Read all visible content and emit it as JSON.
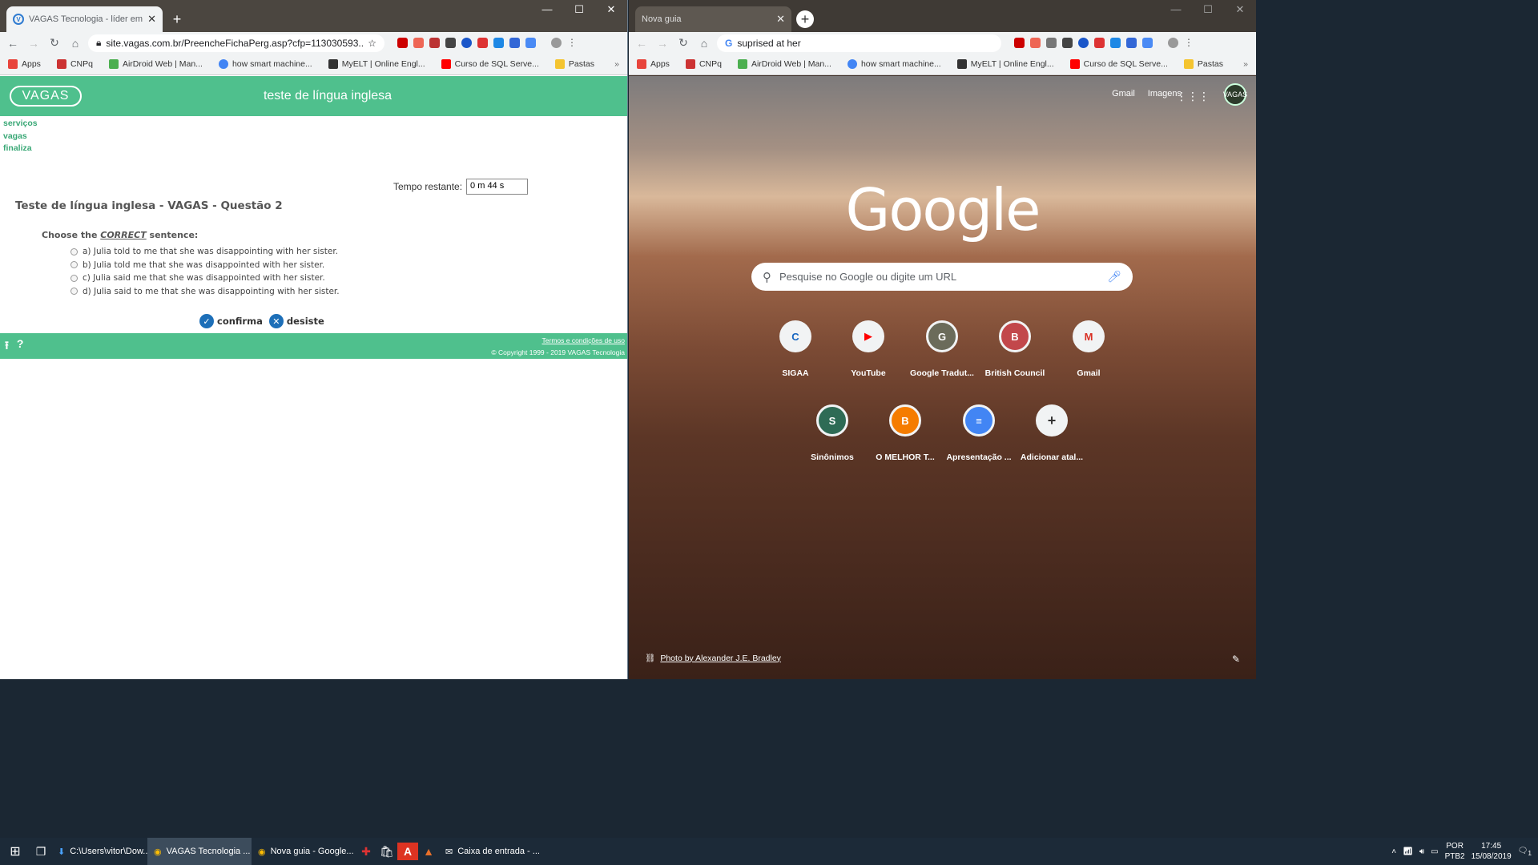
{
  "left_window": {
    "tab_title": "VAGAS Tecnologia - líder em solu",
    "url": "site.vagas.com.br/PreencheFichaPerg.asp?cfp=113030593...",
    "window_controls": [
      "—",
      "☐",
      "✕"
    ],
    "bookmarks": [
      {
        "label": "Apps",
        "color": "#e8453c"
      },
      {
        "label": "CNPq",
        "color": "#c33"
      },
      {
        "label": "AirDroid Web | Man...",
        "color": "#4caf50"
      },
      {
        "label": "how smart machine...",
        "color": "#4285f4"
      },
      {
        "label": "MyELT | Online Engl...",
        "color": "#333"
      },
      {
        "label": "Curso de SQL Serve...",
        "color": "#ff0000"
      },
      {
        "label": "Pastas",
        "color": "#f4c430"
      }
    ],
    "page": {
      "logo": "VAGAS",
      "header_title": "teste de língua inglesa",
      "nav": [
        "serviços",
        "vagas",
        "finaliza"
      ],
      "timer_label": "Tempo restante:",
      "timer_value": "0 m 44 s",
      "question_title": "Teste de língua inglesa - VAGAS - Questão 2",
      "prompt_pre": "Choose the ",
      "prompt_em": "CORRECT",
      "prompt_post": " sentence:",
      "options": [
        "a) Julia told to me that she was disappointing with her sister.",
        "b) Julia told me that she was disappointed with her sister.",
        "c) Julia said me that she was disappointed with her sister.",
        "d) Julia said to me that she was disappointing with her sister."
      ],
      "confirm_label": "confirma",
      "cancel_label": "desiste",
      "terms": "Termos e condições de uso",
      "copyright": "© Copyright 1999 - 2019 VAGAS Tecnologia"
    }
  },
  "right_window": {
    "tab_title": "Nova guia",
    "omnibox_text": "suprised at her",
    "window_controls": [
      "—",
      "☐",
      "✕"
    ],
    "header_links": [
      "Gmail",
      "Imagens"
    ],
    "avatar_label": "VAGAS",
    "google_logo": "Google",
    "search_placeholder": "Pesquise no Google ou digite um URL",
    "shortcuts": [
      {
        "label": "SIGAA",
        "glyph": "C",
        "color": "#1565c0"
      },
      {
        "label": "YouTube",
        "glyph": "▶",
        "color": "#ff0000"
      },
      {
        "label": "Google Tradut...",
        "glyph": "G",
        "color": "#6b6b5a"
      },
      {
        "label": "British Council",
        "glyph": "B",
        "color": "#c2474b"
      },
      {
        "label": "Gmail",
        "glyph": "M",
        "color": "#d93025"
      },
      {
        "label": "Sinônimos",
        "glyph": "S",
        "color": "#2e6b55"
      },
      {
        "label": "O MELHOR T...",
        "glyph": "B",
        "color": "#f57c00"
      },
      {
        "label": "Apresentação ...",
        "glyph": "≡",
        "color": "#4285f4"
      },
      {
        "label": "Adicionar atal...",
        "glyph": "+",
        "color": "#333"
      }
    ],
    "photo_credit": "Photo by Alexander J.E. Bradley"
  },
  "taskbar": {
    "items": [
      {
        "label": "C:\\Users\\vitor\\Dow...",
        "icon": "download-icon",
        "active": false
      },
      {
        "label": "VAGAS Tecnologia ...",
        "icon": "chrome-icon",
        "active": true
      },
      {
        "label": "Nova guia - Google...",
        "icon": "chrome-icon",
        "active": false
      },
      {
        "label": "",
        "icon": "uk-flag-icon",
        "active": false
      },
      {
        "label": "",
        "icon": "store-icon",
        "active": false
      },
      {
        "label": "",
        "icon": "acrobat-icon",
        "active": false
      },
      {
        "label": "",
        "icon": "matlab-icon",
        "active": false
      },
      {
        "label": "Caixa de entrada - ...",
        "icon": "mail-icon",
        "active": false
      }
    ],
    "lang": "POR",
    "lang2": "PTB2",
    "time": "17:45",
    "date": "15/08/2019",
    "notif_count": "1"
  }
}
